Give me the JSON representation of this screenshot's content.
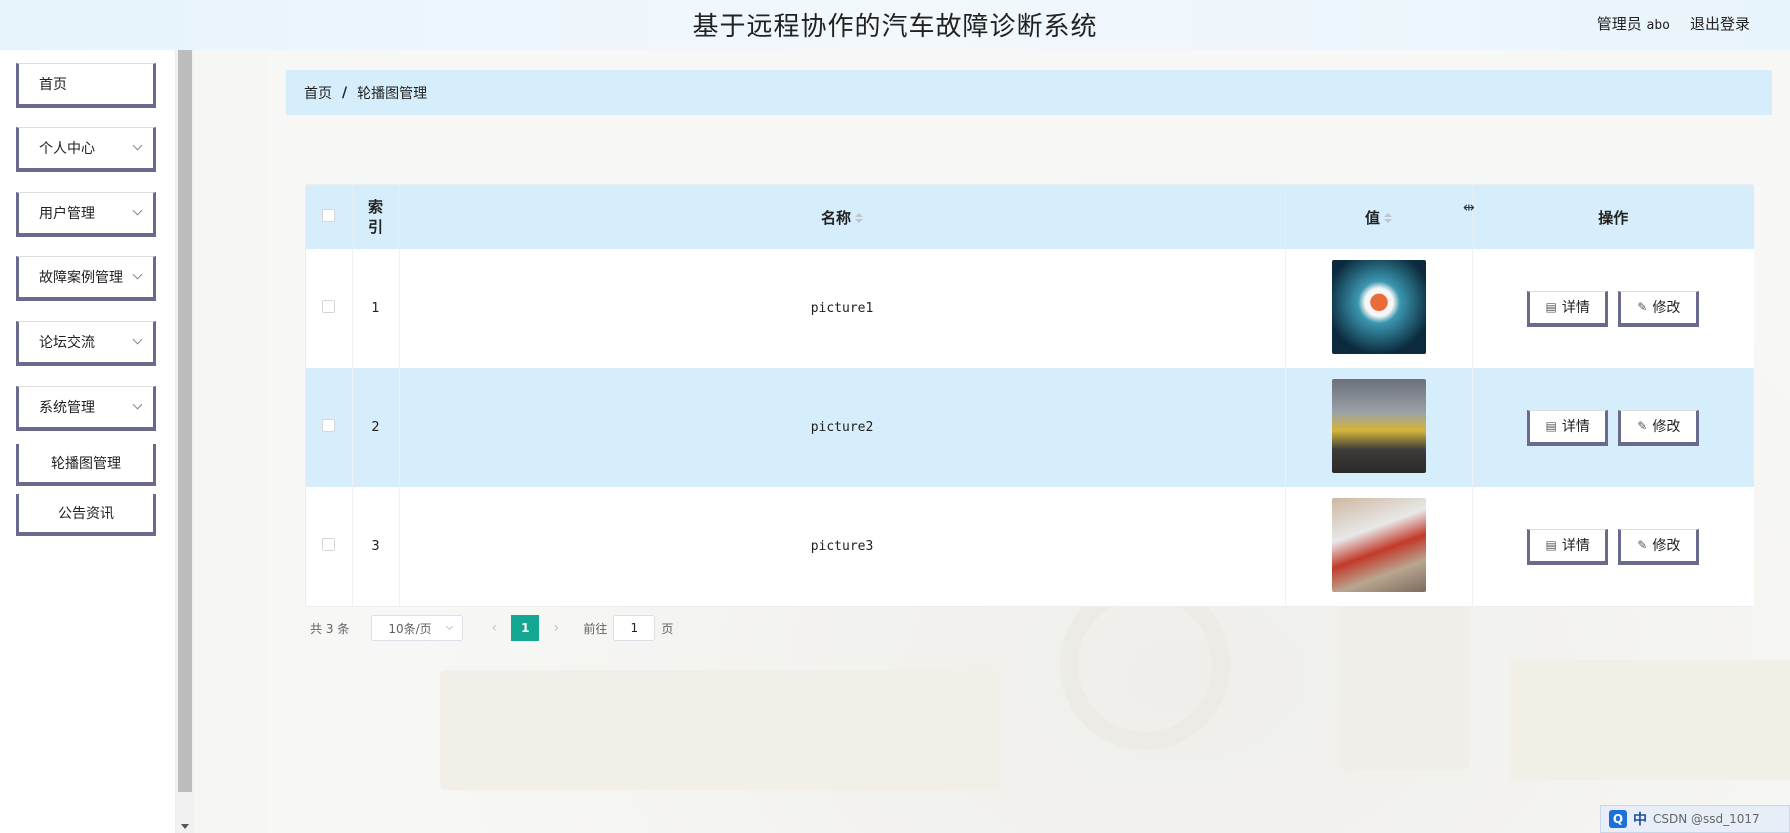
{
  "header": {
    "title": "基于远程协作的汽车故障诊断系统",
    "user_role": "管理员",
    "user_name": "abo",
    "logout": "退出登录"
  },
  "sidebar": {
    "items": [
      {
        "label": "首页",
        "has_chevron": false
      },
      {
        "label": "个人中心",
        "has_chevron": true
      },
      {
        "label": "用户管理",
        "has_chevron": true
      },
      {
        "label": "故障案例管理",
        "has_chevron": true
      },
      {
        "label": "论坛交流",
        "has_chevron": true
      },
      {
        "label": "系统管理",
        "has_chevron": true
      }
    ],
    "sub_items": [
      {
        "label": "轮播图管理"
      },
      {
        "label": "公告资讯"
      }
    ]
  },
  "breadcrumb": {
    "home": "首页",
    "separator": "/",
    "current": "轮播图管理"
  },
  "table": {
    "headers": {
      "index": "索引",
      "name": "名称",
      "value": "值",
      "actions": "操作"
    },
    "rows": [
      {
        "index": "1",
        "name": "picture1",
        "image": "thumb1"
      },
      {
        "index": "2",
        "name": "picture2",
        "image": "thumb2"
      },
      {
        "index": "3",
        "name": "picture3",
        "image": "thumb3"
      }
    ],
    "detail_label": "详情",
    "edit_label": "修改"
  },
  "pagination": {
    "total_prefix": "共",
    "total_count": "3",
    "total_suffix": "条",
    "page_size": "10条/页",
    "current_page": "1",
    "goto_label": "前往",
    "goto_value": "1",
    "page_suffix": "页"
  },
  "tray": {
    "input_method": "中",
    "watermark": "CSDN @ssd_1017"
  }
}
